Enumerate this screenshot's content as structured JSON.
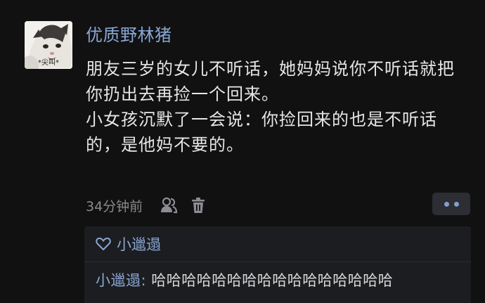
{
  "post": {
    "avatar_caption": "*尖叫*",
    "username": "优质野林猪",
    "paragraphs": [
      "朋友三岁的女儿不听话，她妈妈说你不听话就把你扔出去再捡一个回来。",
      "小女孩沉默了一会说：你捡回来的也是不听话的，是他妈不要的。"
    ],
    "timestamp": "34分钟前",
    "icons": {
      "mention": "users-icon",
      "delete": "trash-icon",
      "more": "more-dots-icon",
      "like": "heart-icon"
    }
  },
  "likes": {
    "names": "小邋遢"
  },
  "reply": {
    "author": "小邋遢:",
    "text": " 哈哈哈哈哈哈哈哈哈哈哈哈哈哈哈哈"
  },
  "colors": {
    "background": "#111112",
    "username": "#8aa7d4",
    "text": "#e6e6e6",
    "muted": "#8a8a8a",
    "panel": "#1c1d20"
  }
}
